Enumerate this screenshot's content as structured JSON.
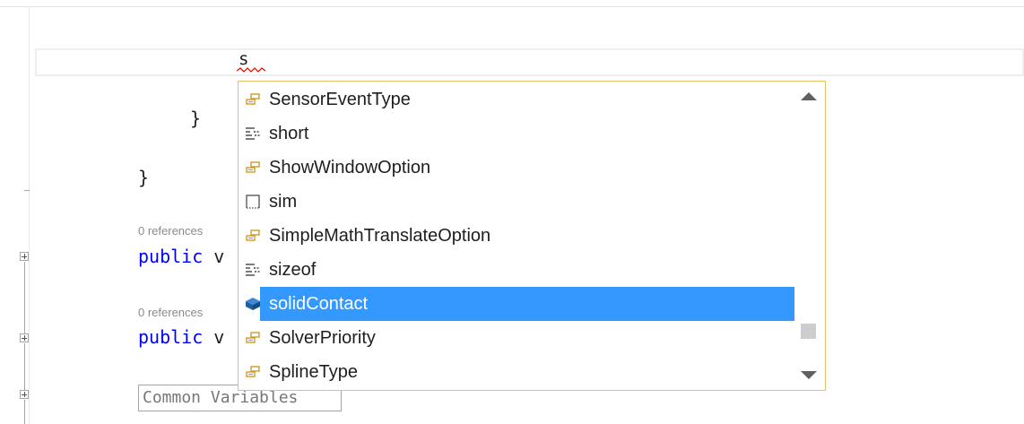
{
  "editor": {
    "typed_text": "s",
    "lines": {
      "inner_brace": "}",
      "outer_brace": "}",
      "code_lens_1": "0 references",
      "method_1_kw": "public",
      "method_1_rest": " v",
      "code_lens_2": "0 references",
      "method_2_kw": "public",
      "method_2_rest": " v",
      "region_label": "Common Variables"
    }
  },
  "completion_list": {
    "items": [
      {
        "label": "SensorEventType",
        "icon": "enum-icon"
      },
      {
        "label": "short",
        "icon": "keyword-icon"
      },
      {
        "label": "ShowWindowOption",
        "icon": "enum-icon"
      },
      {
        "label": "sim",
        "icon": "snippet-icon"
      },
      {
        "label": "SimpleMathTranslateOption",
        "icon": "enum-icon"
      },
      {
        "label": "sizeof",
        "icon": "keyword-icon"
      },
      {
        "label": "solidContact",
        "icon": "field-icon",
        "selected": true
      },
      {
        "label": "SolverPriority",
        "icon": "enum-icon"
      },
      {
        "label": "SplineType",
        "icon": "enum-icon"
      }
    ],
    "scroll_thumb_fraction": 0.78
  },
  "colors": {
    "keyword": "#0000ff",
    "selection": "#3399ff",
    "popup_border": "#e5c365",
    "enum_icon": "#d19a2a",
    "field_icon": "#1f5f9e"
  }
}
